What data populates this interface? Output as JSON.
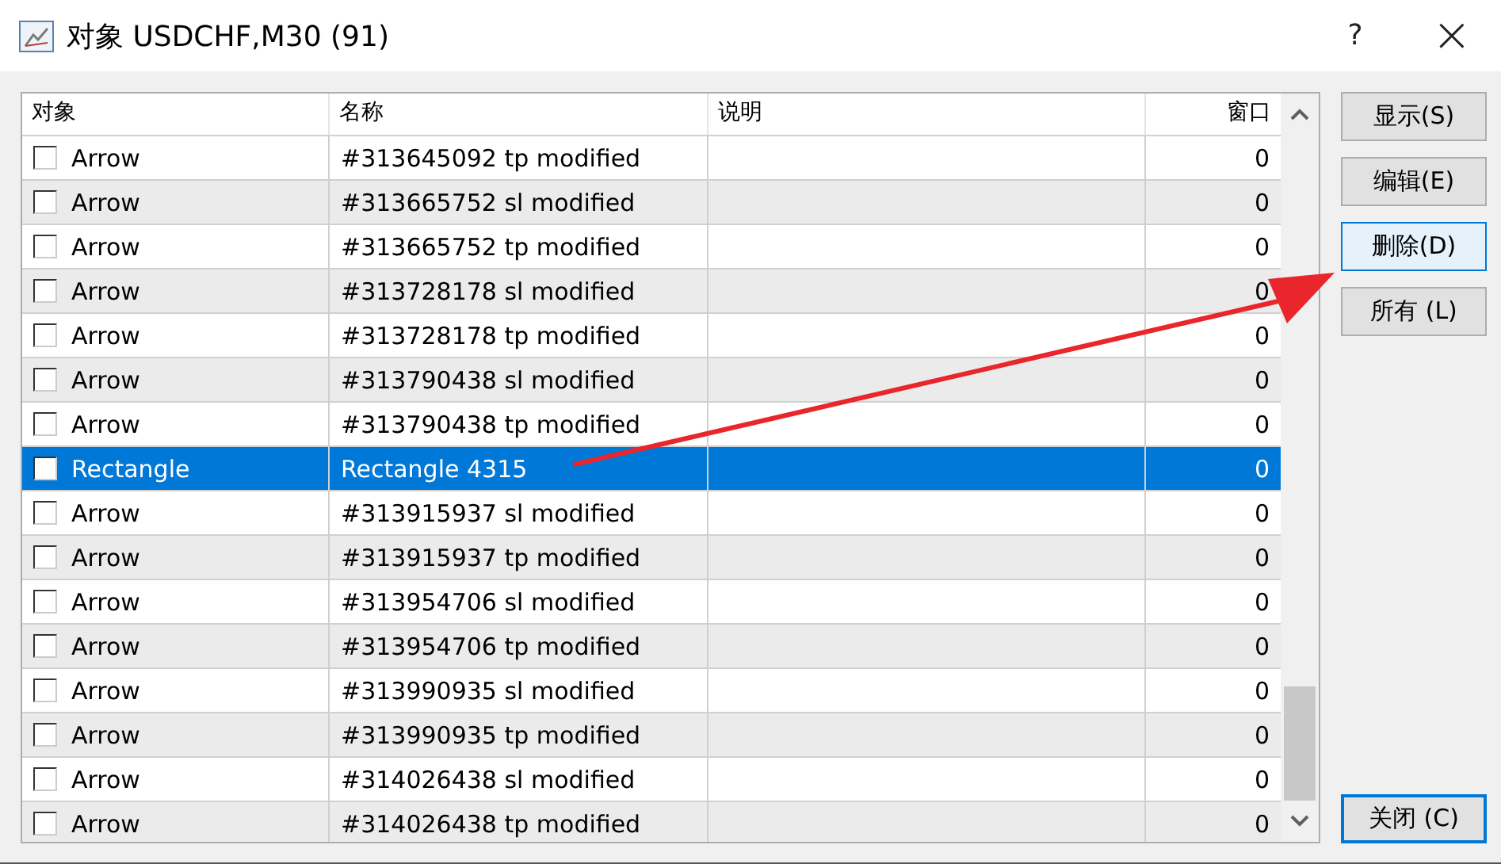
{
  "window": {
    "title": "对象 USDCHF,M30 (91)",
    "help": "?",
    "close": "×"
  },
  "table": {
    "columns": [
      "对象",
      "名称",
      "说明",
      "窗口"
    ],
    "rows": [
      {
        "object": "Arrow",
        "name": "#313645092 tp modified",
        "window": "0",
        "checked": false,
        "selected": false
      },
      {
        "object": "Arrow",
        "name": "#313665752 sl modified",
        "window": "0",
        "checked": false,
        "selected": false
      },
      {
        "object": "Arrow",
        "name": "#313665752 tp modified",
        "window": "0",
        "checked": false,
        "selected": false
      },
      {
        "object": "Arrow",
        "name": "#313728178 sl modified",
        "window": "0",
        "checked": false,
        "selected": false
      },
      {
        "object": "Arrow",
        "name": "#313728178 tp modified",
        "window": "0",
        "checked": false,
        "selected": false
      },
      {
        "object": "Arrow",
        "name": "#313790438 sl modified",
        "window": "0",
        "checked": false,
        "selected": false
      },
      {
        "object": "Arrow",
        "name": "#313790438 tp modified",
        "window": "0",
        "checked": false,
        "selected": false
      },
      {
        "object": "Rectangle",
        "name": "Rectangle 4315",
        "window": "0",
        "checked": false,
        "selected": true
      },
      {
        "object": "Arrow",
        "name": "#313915937 sl modified",
        "window": "0",
        "checked": false,
        "selected": false
      },
      {
        "object": "Arrow",
        "name": "#313915937 tp modified",
        "window": "0",
        "checked": false,
        "selected": false
      },
      {
        "object": "Arrow",
        "name": "#313954706 sl modified",
        "window": "0",
        "checked": false,
        "selected": false
      },
      {
        "object": "Arrow",
        "name": "#313954706 tp modified",
        "window": "0",
        "checked": false,
        "selected": false
      },
      {
        "object": "Arrow",
        "name": "#313990935 sl modified",
        "window": "0",
        "checked": false,
        "selected": false
      },
      {
        "object": "Arrow",
        "name": "#313990935 tp modified",
        "window": "0",
        "checked": false,
        "selected": false
      },
      {
        "object": "Arrow",
        "name": "#314026438 sl modified",
        "window": "0",
        "checked": false,
        "selected": false
      },
      {
        "object": "Arrow",
        "name": "#314026438 tp modified",
        "window": "0",
        "checked": false,
        "selected": false
      }
    ]
  },
  "buttons": [
    {
      "label": "显示(S)",
      "highlighted": false,
      "default": false
    },
    {
      "label": "编辑(E)",
      "highlighted": false,
      "default": false
    },
    {
      "label": "删除(D)",
      "highlighted": true,
      "default": false
    },
    {
      "label": "所有 (L)",
      "highlighted": false,
      "default": false
    }
  ],
  "close_button": {
    "label": "关闭 (C)",
    "highlighted": false,
    "default": true
  }
}
